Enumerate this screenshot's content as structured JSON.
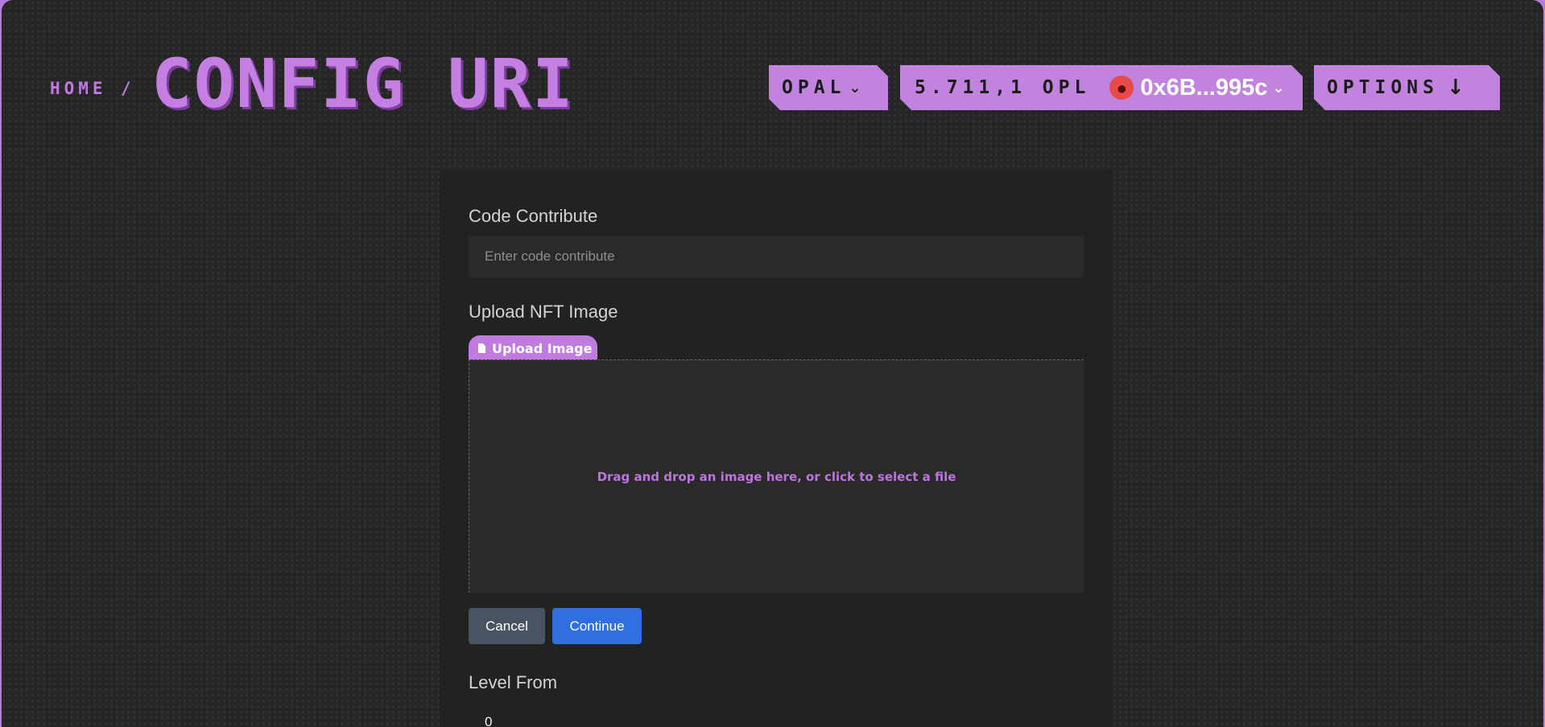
{
  "header": {
    "breadcrumb_home": "HOME",
    "breadcrumb_separator": "/",
    "title": "CONFIG URI",
    "network_label": "OPAL",
    "balance": "5.711,1 OPL",
    "wallet_address": "0x6B...995c",
    "options_label": "OPTIONS",
    "icons": {
      "network": "chevron-down-icon",
      "wallet_avatar": "avatar-icon",
      "wallet": "chevron-down-icon",
      "options": "arrow-down-icon"
    }
  },
  "form": {
    "code_label": "Code Contribute",
    "code_placeholder": "Enter code contribute",
    "code_value": "",
    "upload_label": "Upload NFT Image",
    "upload_tab_label": "Upload Image",
    "dropzone_text": "Drag and drop an image here, or click to select a file",
    "cancel_label": "Cancel",
    "continue_label": "Continue",
    "level_from_label": "Level From",
    "level_from_value": "0"
  },
  "colors": {
    "accent": "#c283df",
    "background": "#262626",
    "panel": "#222222",
    "primary_button": "#2f6fe0",
    "secondary_button": "#4a5361",
    "avatar": "#e84a4a"
  }
}
